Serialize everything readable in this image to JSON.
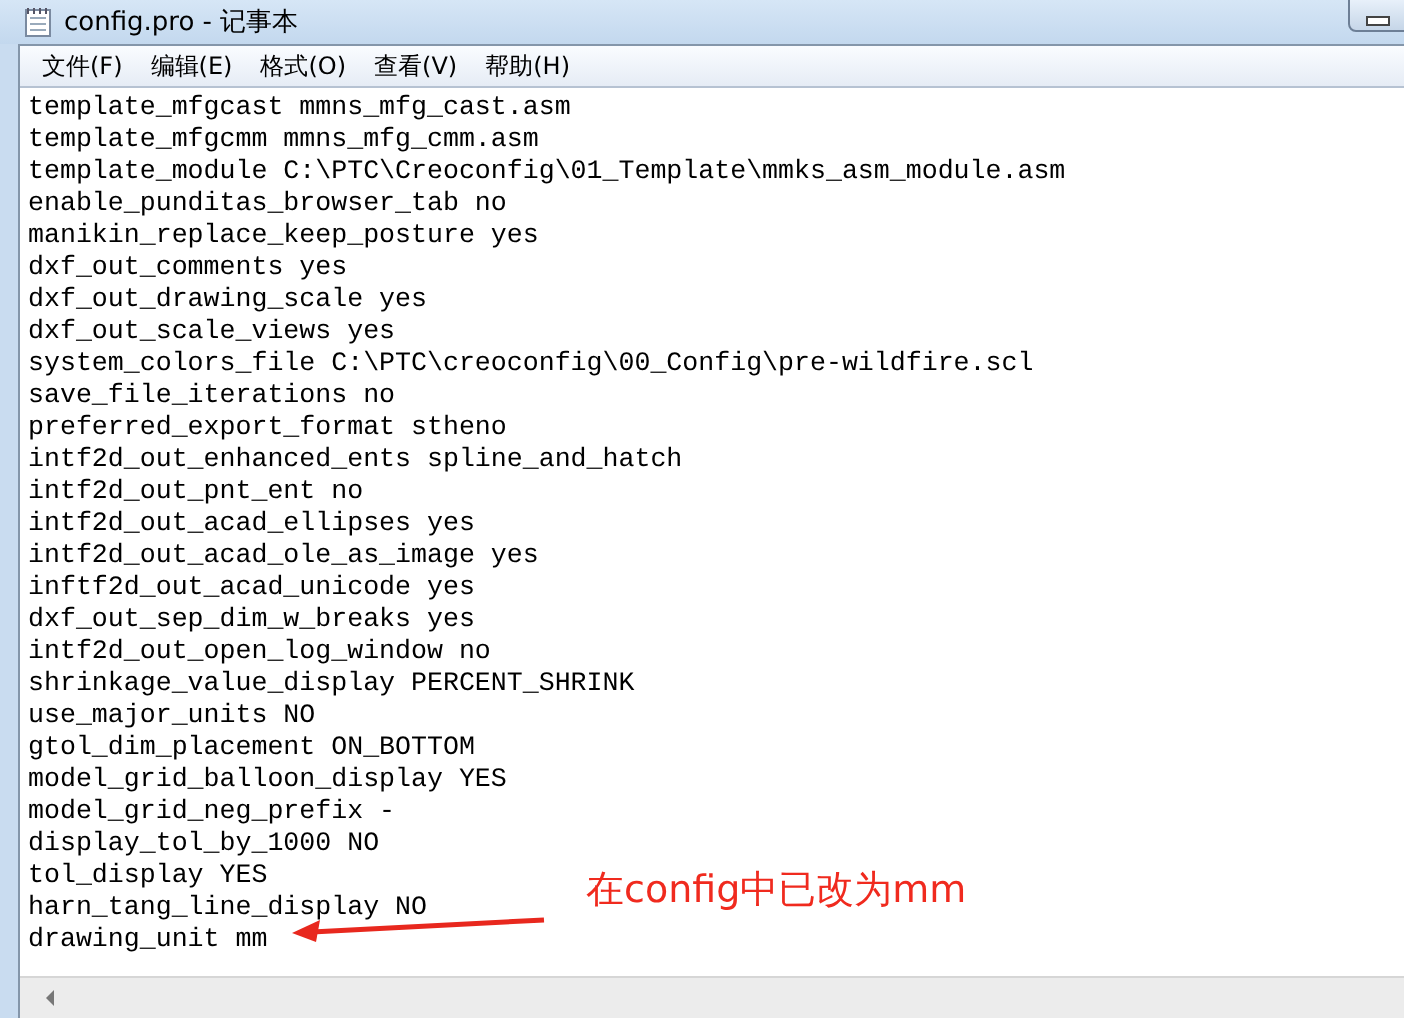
{
  "window": {
    "title": "config.pro - 记事本"
  },
  "menu": [
    "文件(F)",
    "编辑(E)",
    "格式(O)",
    "查看(V)",
    "帮助(H)"
  ],
  "lines": [
    "template_mfgcast mmns_mfg_cast.asm",
    "template_mfgcmm mmns_mfg_cmm.asm",
    "template_module C:\\PTC\\Creoconfig\\01_Template\\mmks_asm_module.asm",
    "enable_punditas_browser_tab no",
    "manikin_replace_keep_posture yes",
    "dxf_out_comments yes",
    "dxf_out_drawing_scale yes",
    "dxf_out_scale_views yes",
    "system_colors_file C:\\PTC\\creoconfig\\00_Config\\pre-wildfire.scl",
    "save_file_iterations no",
    "preferred_export_format stheno",
    "intf2d_out_enhanced_ents spline_and_hatch",
    "intf2d_out_pnt_ent no",
    "intf2d_out_acad_ellipses yes",
    "intf2d_out_acad_ole_as_image yes",
    "inftf2d_out_acad_unicode yes",
    "dxf_out_sep_dim_w_breaks yes",
    "intf2d_out_open_log_window no",
    "shrinkage_value_display PERCENT_SHRINK",
    "use_major_units NO",
    "gtol_dim_placement ON_BOTTOM",
    "model_grid_balloon_display YES",
    "model_grid_neg_prefix -",
    "display_tol_by_1000 NO",
    "tol_display YES",
    "harn_tang_line_display NO",
    "drawing_unit mm"
  ],
  "annotation": {
    "text": "在config中已改为mm"
  }
}
